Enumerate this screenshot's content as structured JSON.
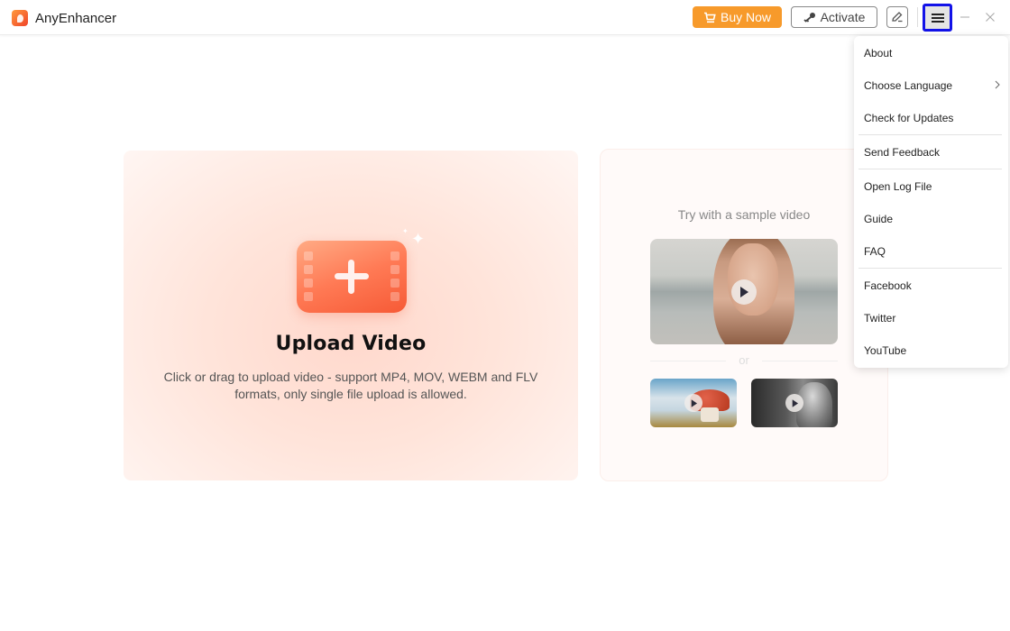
{
  "app": {
    "title": "AnyEnhancer",
    "logo_icon": "anyenhancer-logo"
  },
  "titlebar": {
    "buy_now_label": "Buy Now",
    "buy_now_icon": "cart-icon",
    "activate_label": "Activate",
    "activate_icon": "key-icon",
    "edit_icon": "pen-icon",
    "menu_icon": "hamburger-icon",
    "minimize_icon": "minimize-icon",
    "close_icon": "close-icon",
    "colors": {
      "buy_now_bg": "#f79a2b",
      "menu_focus_border": "#1212e8"
    }
  },
  "upload": {
    "title": "Upload Video",
    "description": "Click or drag to upload video - support MP4, MOV, WEBM and FLV formats, only single file upload is allowed.",
    "icon": "add-video-icon"
  },
  "samples": {
    "title": "Try with a sample video",
    "separator": "or",
    "videos": [
      {
        "subject": "woman on beach",
        "play_icon": "play-icon"
      },
      {
        "subject": "mushroom house",
        "play_icon": "play-icon"
      },
      {
        "subject": "elderly man black and white",
        "play_icon": "play-icon"
      }
    ]
  },
  "menu": {
    "items": [
      {
        "label": "About"
      },
      {
        "label": "Choose Language",
        "submenu": true
      },
      {
        "label": "Check for Updates"
      },
      {
        "label": "Send Feedback"
      },
      {
        "label": "Open Log File"
      },
      {
        "label": "Guide"
      },
      {
        "label": "FAQ"
      },
      {
        "label": "Facebook"
      },
      {
        "label": "Twitter"
      },
      {
        "label": "YouTube"
      }
    ]
  }
}
